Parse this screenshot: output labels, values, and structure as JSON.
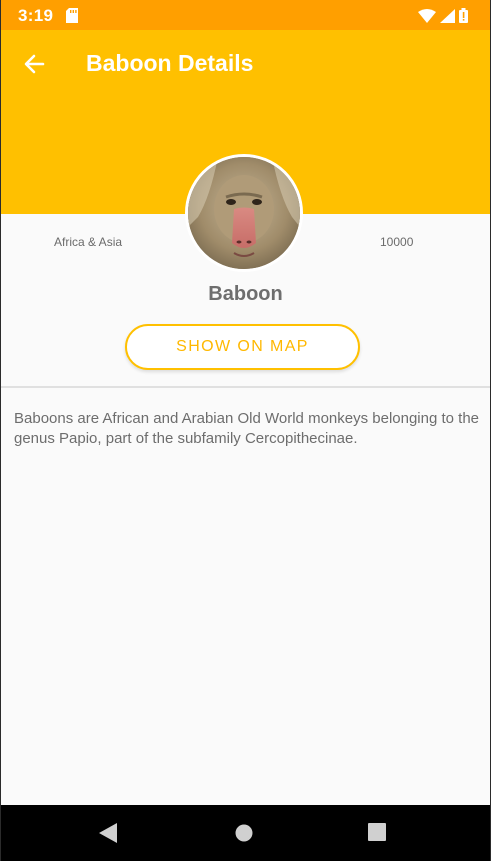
{
  "status_bar": {
    "time": "3:19",
    "icons": [
      "sd-card-icon",
      "wifi-icon",
      "signal-icon",
      "battery-icon"
    ],
    "color": "#ff9f00"
  },
  "app_bar": {
    "title": "Baboon Details",
    "back_icon": "arrow-left-icon",
    "color": "#ffc000"
  },
  "animal": {
    "name": "Baboon",
    "region": "Africa & Asia",
    "count": "10000",
    "image": "baboon-photo",
    "description": "Baboons are African and Arabian Old World monkeys belonging to the genus Papio, part of the subfamily Cercopithecinae."
  },
  "actions": {
    "show_on_map_label": "SHOW ON MAP"
  },
  "nav_bar": {
    "icons": [
      "back-triangle-icon",
      "home-circle-icon",
      "recents-square-icon"
    ]
  }
}
